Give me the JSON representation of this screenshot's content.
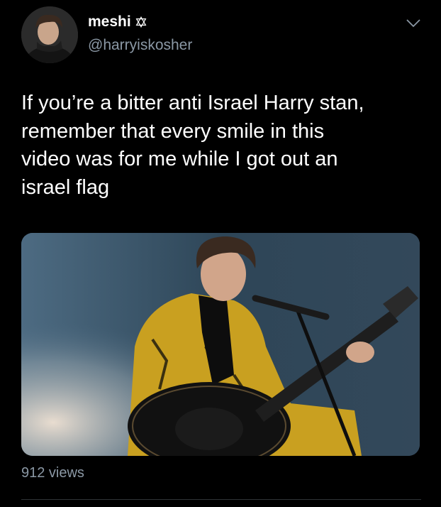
{
  "author": {
    "display_name": "meshi",
    "handle": "@harryiskosher",
    "badge_icon": "star-of-david-icon"
  },
  "tweet": {
    "text": "If you’re a bitter anti Israel Harry stan,\nremember that every smile in this\nvideo was for me while I got out an\nisrael flag"
  },
  "media": {
    "type": "video-thumbnail"
  },
  "footer": {
    "views": "912 views"
  },
  "colors": {
    "background": "#000000",
    "text_primary": "#ffffff",
    "text_secondary": "#8b98a5",
    "divider": "#2f3336"
  }
}
